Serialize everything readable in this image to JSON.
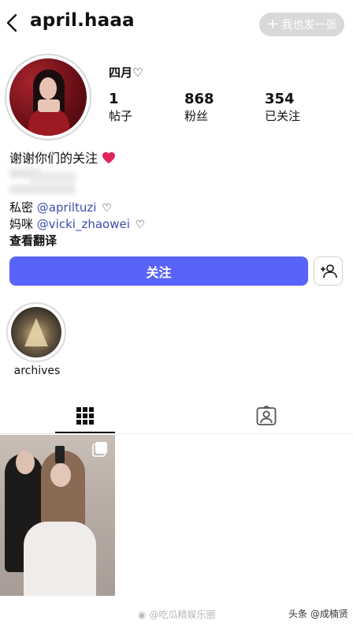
{
  "header": {
    "username": "april.haaa",
    "post_button_label": "我也发一张"
  },
  "profile": {
    "display_name": "四月♡",
    "stats": [
      {
        "value": "1",
        "label": "帖子"
      },
      {
        "value": "868",
        "label": "粉丝"
      },
      {
        "value": "354",
        "label": "已关注"
      }
    ],
    "bio_line1": "谢谢你们的关注",
    "bio_private_prefix": "私密",
    "bio_private_mention": "@apriltuzi",
    "bio_mom_prefix": "妈咪",
    "bio_mom_mention": "@vicki_zhaowei",
    "translate_label": "查看翻译"
  },
  "actions": {
    "follow_label": "关注"
  },
  "highlights": [
    {
      "label": "archives"
    }
  ],
  "watermarks": {
    "left": "@吃瓜精娱乐圈",
    "right": "头条 @成楠贤"
  },
  "colors": {
    "follow_button": "#5a63f8",
    "mention": "#3d4bb0",
    "heart": "#e0245e"
  }
}
